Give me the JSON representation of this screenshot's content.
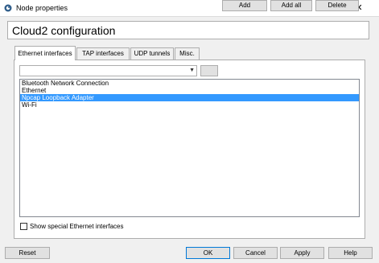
{
  "window": {
    "title": "Node properties",
    "help_glyph": "?",
    "close_glyph": "✕",
    "icon": "gns3-app-icon"
  },
  "header": {
    "title": "Cloud2 configuration"
  },
  "tabs": [
    {
      "label": "Ethernet interfaces",
      "active": true
    },
    {
      "label": "TAP interfaces",
      "active": false
    },
    {
      "label": "UDP tunnels",
      "active": false
    },
    {
      "label": "Misc.",
      "active": false
    }
  ],
  "ethernet": {
    "combo_value": "",
    "combo_arrow": "▼",
    "buttons": {
      "add": "Add",
      "add_all": "Add all",
      "delete": "Delete"
    },
    "interfaces": [
      {
        "name": "Bluetooth Network Connection",
        "selected": false
      },
      {
        "name": "Ethernet",
        "selected": false
      },
      {
        "name": "Npcap Loopback Adapter",
        "selected": true
      },
      {
        "name": "Wi-Fi",
        "selected": false
      }
    ],
    "show_special_label": "Show special Ethernet interfaces",
    "show_special_checked": false
  },
  "footer": {
    "reset": "Reset",
    "ok": "OK",
    "cancel": "Cancel",
    "apply": "Apply",
    "help": "Help"
  },
  "colors": {
    "selection": "#3399ff",
    "default_button_border": "#0078d7"
  }
}
